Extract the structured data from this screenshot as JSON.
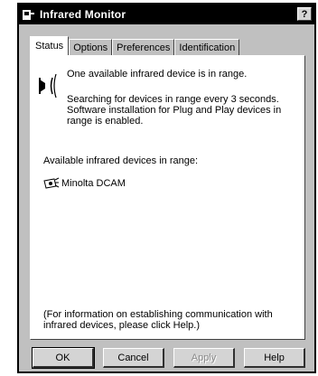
{
  "window": {
    "title": "Infrared Monitor",
    "help_glyph": "?"
  },
  "tabs": [
    {
      "label": "Status",
      "active": true
    },
    {
      "label": "Options",
      "active": false
    },
    {
      "label": "Preferences",
      "active": false
    },
    {
      "label": "Identification",
      "active": false
    }
  ],
  "status": {
    "in_range": "One available infrared device is in range.",
    "searching": "Searching for devices in range every 3 seconds. Software installation for Plug and Play devices in range is enabled.",
    "devices_label": "Available infrared devices in range:",
    "devices": [
      {
        "name": "Minolta DCAM",
        "icon": "camera-icon"
      }
    ],
    "info": "(For information on establishing communication with infrared devices, please click Help.)"
  },
  "buttons": {
    "ok": "OK",
    "cancel": "Cancel",
    "apply": "Apply",
    "help": "Help"
  },
  "colors": {
    "face": "#c0c0c0",
    "titlebar": "#000000",
    "panel": "#ffffff"
  }
}
